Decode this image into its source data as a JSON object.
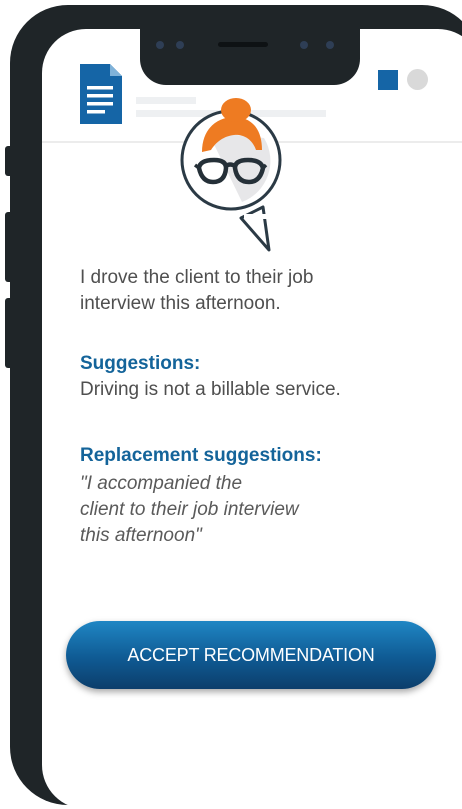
{
  "statement": {
    "lines": [
      "I drove the client to their job",
      "interview this afternoon."
    ]
  },
  "suggestions": {
    "heading": "Suggestions:",
    "text": "Driving is not a billable service."
  },
  "replacement": {
    "heading": "Replacement suggestions:",
    "lines": [
      "\"I accompanied the",
      "client to their job interview",
      "this afternoon\""
    ]
  },
  "accept_button": {
    "label": "ACCEPT RECOMMENDATION"
  },
  "icons": {
    "document": "document-icon",
    "avatar": "assistant-avatar-icon",
    "status_square": "status-square-icon",
    "status_dot": "status-dot-icon"
  },
  "colors": {
    "accent": "#14649a",
    "button_gradient_top": "#1f86c4",
    "button_gradient_bottom": "#0c3e6b",
    "hair": "#ee7b22",
    "phone_frame": "#1f2528"
  }
}
